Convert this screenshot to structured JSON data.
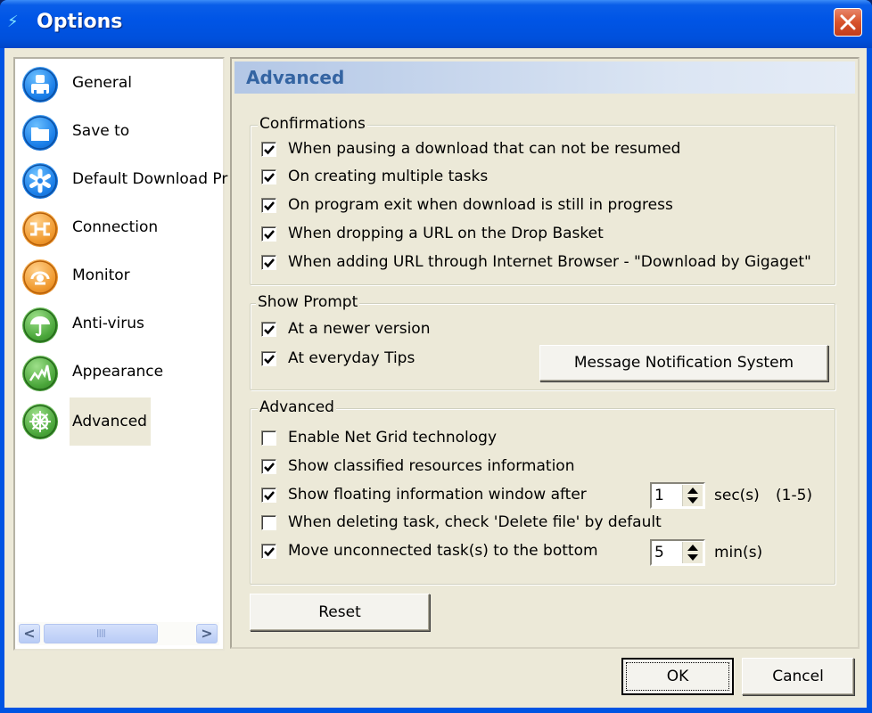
{
  "window": {
    "title": "Options",
    "close_label": "Close"
  },
  "sidebar": {
    "items": [
      {
        "label": "General",
        "icon": "user-icon",
        "color": "blue"
      },
      {
        "label": "Save to",
        "icon": "folder-icon",
        "color": "blue"
      },
      {
        "label": "Default Download Pr",
        "icon": "asterisk-icon",
        "color": "blue"
      },
      {
        "label": "Connection",
        "icon": "connection-icon",
        "color": "orange"
      },
      {
        "label": "Monitor",
        "icon": "monitor-icon",
        "color": "orange"
      },
      {
        "label": "Anti-virus",
        "icon": "umbrella-icon",
        "color": "green"
      },
      {
        "label": "Appearance",
        "icon": "chart-wave-icon",
        "color": "green"
      },
      {
        "label": "Advanced",
        "icon": "ship-wheel-icon",
        "color": "green",
        "selected": true
      }
    ],
    "scroll_left": "<",
    "scroll_right": ">",
    "scroll_grip": "IIII"
  },
  "panel": {
    "title": "Advanced",
    "confirmations": {
      "title": "Confirmations",
      "items": [
        {
          "label": "When pausing a download that can not be resumed",
          "checked": true
        },
        {
          "label": "On creating multiple tasks",
          "checked": true
        },
        {
          "label": "On program exit when download is still in progress",
          "checked": true
        },
        {
          "label": "When dropping a URL on the Drop Basket",
          "checked": true
        },
        {
          "label": "When adding URL through Internet Browser - \"Download by Gigaget\"",
          "checked": true
        }
      ]
    },
    "show_prompt": {
      "title": "Show Prompt",
      "items": [
        {
          "label": "At a newer version",
          "checked": true
        },
        {
          "label": "At everyday Tips",
          "checked": true
        }
      ],
      "message_button": "Message Notification System"
    },
    "advanced": {
      "title": "Advanced",
      "items": [
        {
          "label": "Enable Net Grid technology",
          "checked": false
        },
        {
          "label": "Show classified resources information",
          "checked": true
        },
        {
          "label": "Show floating information window after",
          "checked": true
        },
        {
          "label": "When deleting task, check 'Delete file' by default",
          "checked": false
        },
        {
          "label": "Move unconnected task(s) to the bottom",
          "checked": true
        }
      ],
      "float_window_value": "1",
      "float_window_unit": "sec(s)",
      "float_window_range": "(1-5)",
      "move_bottom_value": "5",
      "move_bottom_unit": "min(s)"
    },
    "reset_button": "Reset"
  },
  "footer": {
    "ok_button": "OK",
    "cancel_button": "Cancel"
  }
}
